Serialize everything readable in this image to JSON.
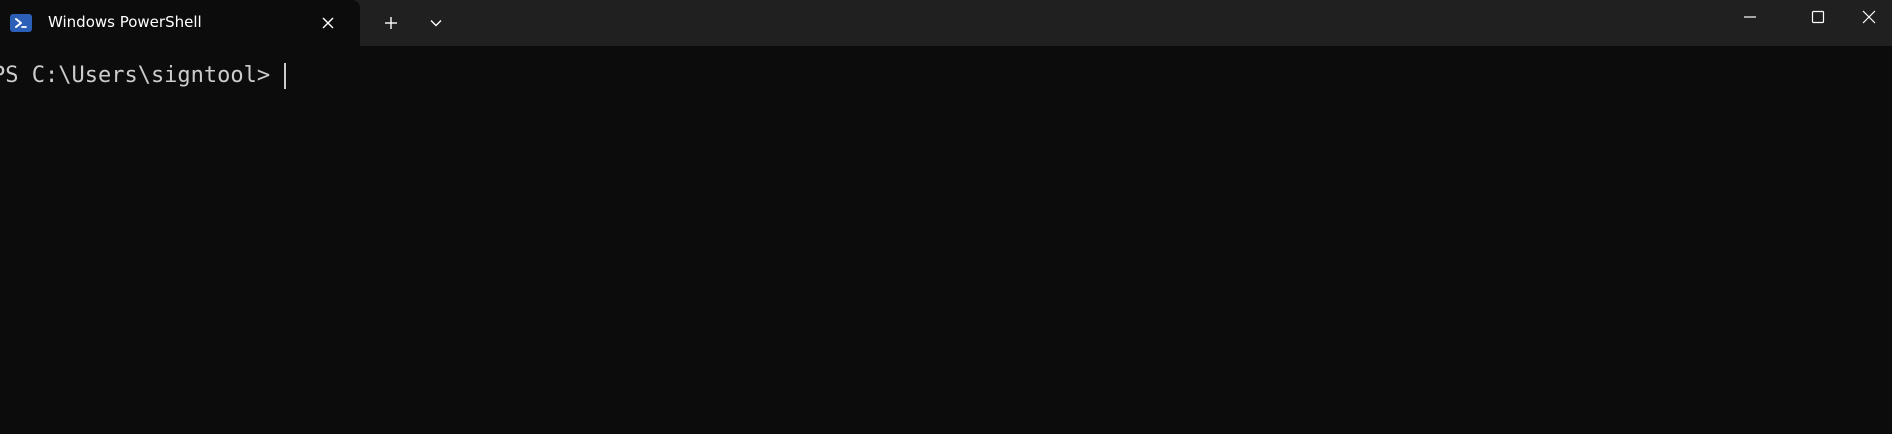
{
  "tab": {
    "title": "Windows PowerShell",
    "icon": "powershell-icon",
    "icon_color": "#2c5fb8"
  },
  "tabbar": {
    "new_tab_icon": "plus-icon",
    "dropdown_icon": "chevron-down-icon"
  },
  "window_controls": {
    "minimize_icon": "minimize-icon",
    "maximize_icon": "maximize-icon",
    "close_icon": "close-icon"
  },
  "terminal": {
    "prompt": "PS C:\\Users\\signtool>",
    "background": "#0c0c0c",
    "foreground": "#cccccc"
  }
}
